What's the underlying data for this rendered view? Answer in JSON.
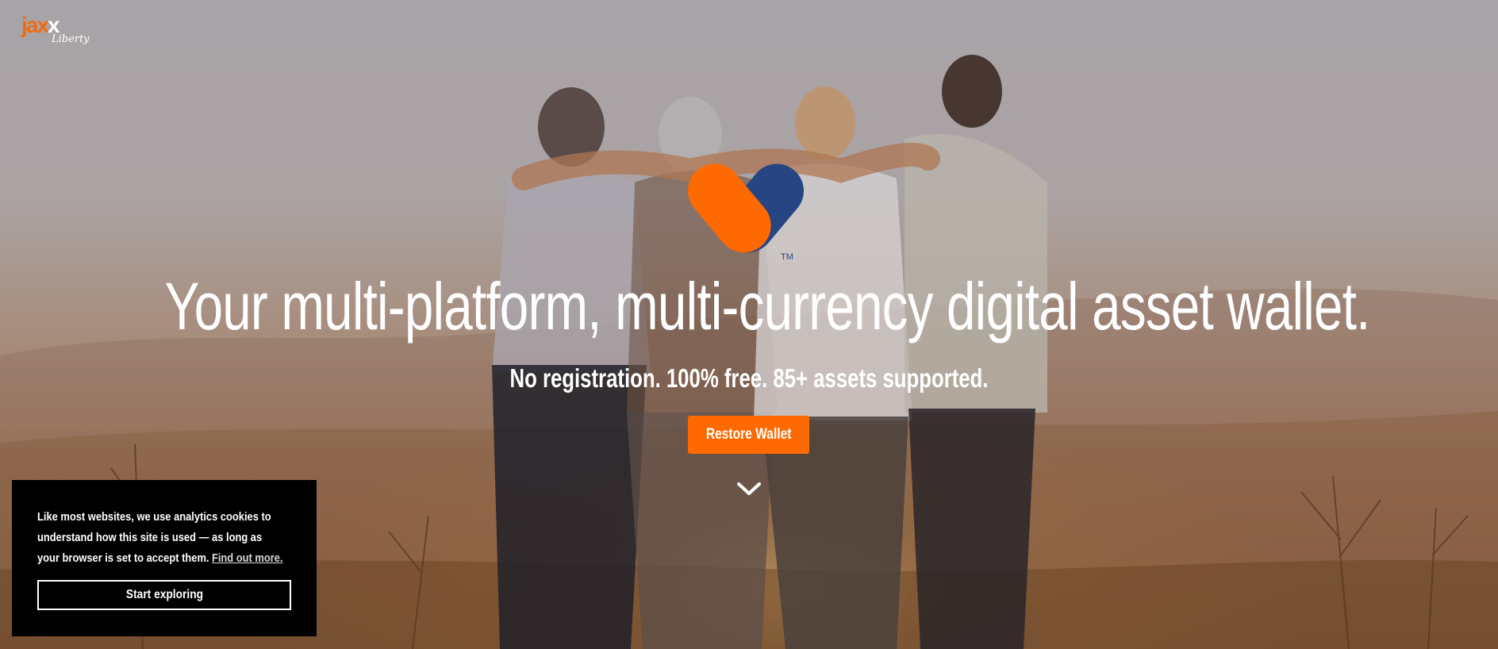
{
  "logo": {
    "wordmark_main": "jax",
    "wordmark_x": "x",
    "wordmark_sub": "Liberty"
  },
  "brand_mark": {
    "icon": "jaxx-heart-logo-icon",
    "trademark": "TM",
    "colors": {
      "orange": "#ff6a00",
      "navy": "#274582"
    }
  },
  "hero": {
    "title": "Your multi-platform, multi-currency digital asset wallet.",
    "subtitle": "No registration. 100% free. 85+ assets supported.",
    "cta_label": "Restore Wallet",
    "scroll_icon": "chevron-down-icon"
  },
  "cookie_banner": {
    "message": "Like most websites, we use analytics cookies to understand how this site is used — as long as your browser is set to accept them.",
    "link_label": "Find out more.",
    "button_label": "Start exploring"
  },
  "colors": {
    "accent": "#ff6a00",
    "banner_bg": "#000000",
    "text": "#ffffff"
  }
}
